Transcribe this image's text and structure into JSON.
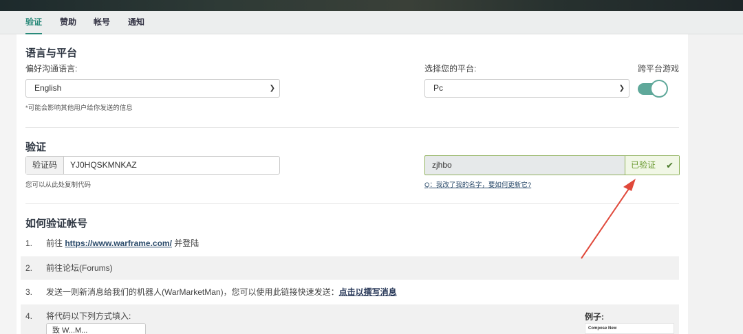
{
  "tabs": [
    {
      "label": "验证",
      "active": true
    },
    {
      "label": "赞助"
    },
    {
      "label": "帐号"
    },
    {
      "label": "通知"
    }
  ],
  "language_section": {
    "title": "语言与平台",
    "language_label": "偏好沟通语言:",
    "language_value": "English",
    "language_hint": "*可能会影响其他用户给你发送的信息",
    "platform_label": "选择您的平台:",
    "platform_value": "Pc",
    "crossplay_label": "跨平台游戏",
    "crossplay_enabled": true
  },
  "verify_section": {
    "title": "验证",
    "code_addon": "验证码",
    "code_value": "YJ0HQSKMNKAZ",
    "code_hint": "您可以从此处复制代码",
    "username_value": "zjhbo",
    "verified_label": "已验证",
    "rename_question": "Q：我改了我的名字，要如何更新它?"
  },
  "howto": {
    "title": "如何验证帐号",
    "steps": [
      {
        "num": "1.",
        "prefix": "前往 ",
        "link": "https://www.warframe.com/",
        "suffix": " 并登陆"
      },
      {
        "num": "2.",
        "text": "前往论坛(Forums)"
      },
      {
        "num": "3.",
        "prefix": "发送一则新消息给我们的机器人(WarMarketMan)，您可以使用此链接快速发送：",
        "link": "点击以撰写消息"
      },
      {
        "num": "4.",
        "text": "将代码以下列方式填入:"
      }
    ],
    "example_label": "例子:",
    "example_preview_text": "Compose New",
    "step4_input_preview": "致 W...M..."
  },
  "colors": {
    "accent": "#2a8a7a",
    "verified_border": "#8eb05a",
    "arrow": "#e0483a"
  }
}
